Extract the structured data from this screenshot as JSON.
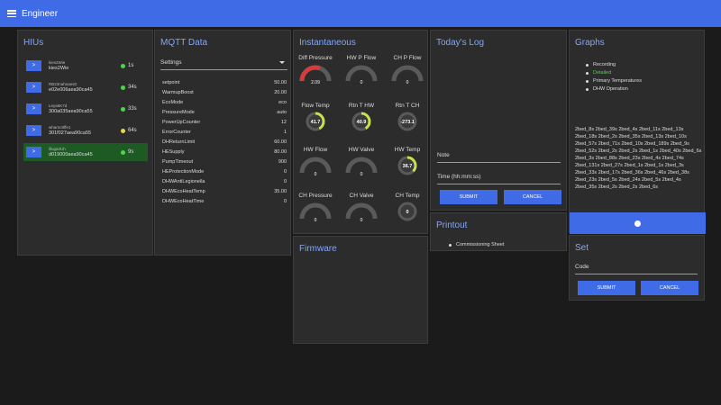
{
  "appbar": {
    "title": "Engineer"
  },
  "hius": {
    "title": "HIUs",
    "button_label": ">",
    "rows": [
      {
        "name": "kies2Wie",
        "id": "kies2Wie",
        "age": "1s",
        "status_color": "#4cd64c"
      },
      {
        "name": "RB23nahnaes0",
        "id": "e02e006aea90ca45",
        "age": "34s",
        "status_color": "#4cd64c"
      },
      {
        "name": "Leya6K7d",
        "id": "300a035aea90ca55",
        "age": "33s",
        "status_color": "#4cd64c"
      },
      {
        "name": "wharnc8ffe1",
        "id": "301f027aea90ca55",
        "age": "64s",
        "status_color": "#e3d94c"
      },
      {
        "name": "illuga3Uh",
        "id": "d019000aea90ca45",
        "age": "9s",
        "status_color": "#4cd64c"
      }
    ]
  },
  "mqtt": {
    "title": "MQTT Data",
    "select_value": "Settings",
    "rows": [
      {
        "key": "setpoint",
        "value": "50.00"
      },
      {
        "key": "WarmupBoost",
        "value": "20.00"
      },
      {
        "key": "EcoMode",
        "value": "eco"
      },
      {
        "key": "PressureMode",
        "value": "auto"
      },
      {
        "key": "PowerUpCounter",
        "value": "12"
      },
      {
        "key": "ErrorCounter",
        "value": "1"
      },
      {
        "key": "DHReturnLimit",
        "value": "60.00"
      },
      {
        "key": "HESupply",
        "value": "80.00"
      },
      {
        "key": "PumpTimeout",
        "value": "900"
      },
      {
        "key": "HEProtectionMode",
        "value": "0"
      },
      {
        "key": "DHWAntiLegionella",
        "value": "0"
      },
      {
        "key": "DHWEcoHeatTemp",
        "value": "35.00"
      },
      {
        "key": "DHWEcoHeatTime",
        "value": "0"
      }
    ]
  },
  "instantaneous": {
    "title": "Instantaneous",
    "gauges": [
      {
        "label": "Diff Pressure",
        "type": "arc",
        "value_text": "2.09",
        "fill": 0.6,
        "color": "#d63c3c"
      },
      {
        "label": "HW P Flow",
        "type": "arc",
        "value_text": "0",
        "fill": 0.0,
        "color": "#d63c3c"
      },
      {
        "label": "CH P Flow",
        "type": "arc",
        "value_text": "0",
        "fill": 0.0,
        "color": "#d63c3c"
      },
      {
        "label": "Flow Temp",
        "type": "ring",
        "value_text": "41.7",
        "fill": 0.42,
        "color": "#c8e04c"
      },
      {
        "label": "Rtn T HW",
        "type": "ring",
        "value_text": "40.9",
        "fill": 0.41,
        "color": "#c8e04c"
      },
      {
        "label": "Rtn T CH",
        "type": "ring",
        "value_text": "-273.1",
        "fill": 0.0,
        "color": "#c8e04c"
      },
      {
        "label": "HW Flow",
        "type": "arc",
        "value_text": "0",
        "fill": 0.0,
        "color": "#d63c3c"
      },
      {
        "label": "HW Valve",
        "type": "arc",
        "value_text": "0",
        "fill": 0.0,
        "color": "#d63c3c"
      },
      {
        "label": "HW Temp",
        "type": "ring",
        "value_text": "36.7",
        "fill": 0.37,
        "color": "#c8e04c"
      },
      {
        "label": "CH Pressure",
        "type": "arc",
        "value_text": "0",
        "fill": 0.0,
        "color": "#d63c3c"
      },
      {
        "label": "CH Valve",
        "type": "arc",
        "value_text": "0",
        "fill": 0.0,
        "color": "#d63c3c"
      },
      {
        "label": "CH Temp",
        "type": "ring",
        "value_text": "0",
        "fill": 0.0,
        "color": "#c8e04c"
      }
    ]
  },
  "firmware": {
    "title": "Firmware"
  },
  "log": {
    "title": "Today's Log",
    "note_placeholder": "Note",
    "time_placeholder": "Time (hh:mm:ss)",
    "submit_label": "SUBMIT",
    "cancel_label": "CANCEL"
  },
  "printout": {
    "title": "Printout",
    "items": [
      "Commissioning Sheet"
    ]
  },
  "graphs": {
    "title": "Graphs",
    "items": [
      {
        "label": "Recording",
        "color": "#dddddd"
      },
      {
        "label": "Detailed",
        "color": "#4cd64c"
      },
      {
        "label": "Primary Temperatures",
        "color": "#dddddd"
      },
      {
        "label": "DHW Operation",
        "color": "#dddddd"
      }
    ],
    "files": "2bed_8s 2bed_39s 2bed_4s 2bed_11s 2bed_13s 2bed_18s 2bed_2s 2bed_35s 2bed_13s 2bed_10s 2bed_57s 2bed_71s 2bed_10s 2bed_189s 2bed_9s 2bed_52s 2bed_2s 2bed_2s 2bed_1s 2bed_40s 2bed_6s 2bed_3s 2bed_88s 2bed_23s 2bed_4s 2bed_74s 2bed_131s 2bed_27s 2bed_1s 2bed_1s 2bed_3s 2bed_33s 2bed_17s 2bed_36s 2bed_46s 2bed_38s 2bed_23s 2bed_5s 2bed_24s 2bed_5s 2bed_4s 2bed_35s 2bed_2s 2bed_2s 2bed_6s"
  },
  "set": {
    "title": "Set",
    "code_placeholder": "Code",
    "submit_label": "SUBMIT",
    "cancel_label": "CANCEL"
  }
}
